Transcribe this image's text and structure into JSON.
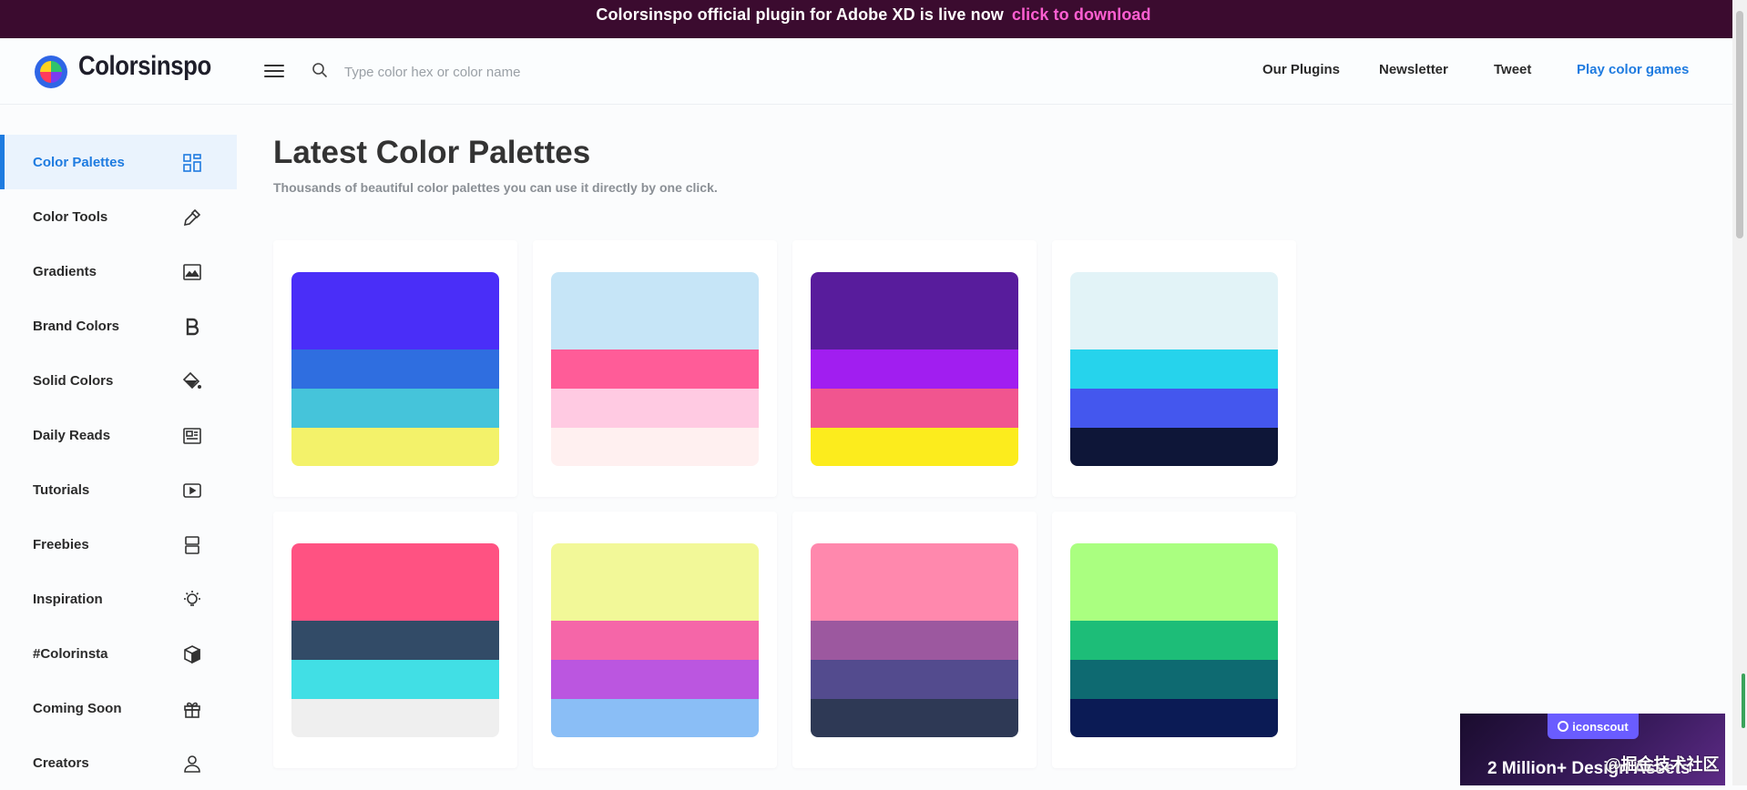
{
  "announcement": {
    "message": "Colorsinspo official plugin for Adobe XD is live now",
    "link_text": "click to download"
  },
  "header": {
    "brand": "Colorsinspo",
    "search_placeholder": "Type color hex or color name",
    "nav": [
      "Our Plugins",
      "Newsletter",
      "Tweet",
      "Play color games"
    ]
  },
  "sidebar": {
    "items": [
      {
        "label": "Color Palettes",
        "icon": "grid-icon",
        "active": true
      },
      {
        "label": "Color Tools",
        "icon": "eyedropper-icon"
      },
      {
        "label": "Gradients",
        "icon": "image-icon"
      },
      {
        "label": "Brand Colors",
        "icon": "bold-b-icon"
      },
      {
        "label": "Solid Colors",
        "icon": "paint-bucket-icon"
      },
      {
        "label": "Daily Reads",
        "icon": "newspaper-icon"
      },
      {
        "label": "Tutorials",
        "icon": "video-play-icon"
      },
      {
        "label": "Freebies",
        "icon": "layers-icon"
      },
      {
        "label": "Inspiration",
        "icon": "bulb-icon"
      },
      {
        "label": "#Colorinsta",
        "icon": "cube-icon"
      },
      {
        "label": "Coming Soon",
        "icon": "gift-icon"
      },
      {
        "label": "Creators",
        "icon": "user-icon"
      }
    ]
  },
  "main": {
    "title": "Latest Color Palettes",
    "subtitle": "Thousands of beautiful color palettes you can use it directly by one click.",
    "palettes": [
      [
        "#4a2ef8",
        "#2f6ee0",
        "#45c4da",
        "#f3f26a"
      ],
      [
        "#c6e5f7",
        "#ff5c98",
        "#ffcae2",
        "#fff0f0"
      ],
      [
        "#581c9c",
        "#a11ef0",
        "#f1558f",
        "#fcec1d"
      ],
      [
        "#e2f3f7",
        "#26d3ec",
        "#4457ee",
        "#0e1638"
      ],
      [
        "#ff5282",
        "#324b67",
        "#41dfe5",
        "#efefef"
      ],
      [
        "#f2f898",
        "#f566a8",
        "#bb56e0",
        "#8abef6"
      ],
      [
        "#ff88ad",
        "#9c589f",
        "#534b8e",
        "#2e3955"
      ],
      [
        "#aaff80",
        "#1dbd78",
        "#0e6a71",
        "#0b1b55"
      ]
    ]
  },
  "ad": {
    "badge": "iconscout",
    "text": "2 Million+ Design Assets"
  },
  "watermark": "@掘金技术社区"
}
